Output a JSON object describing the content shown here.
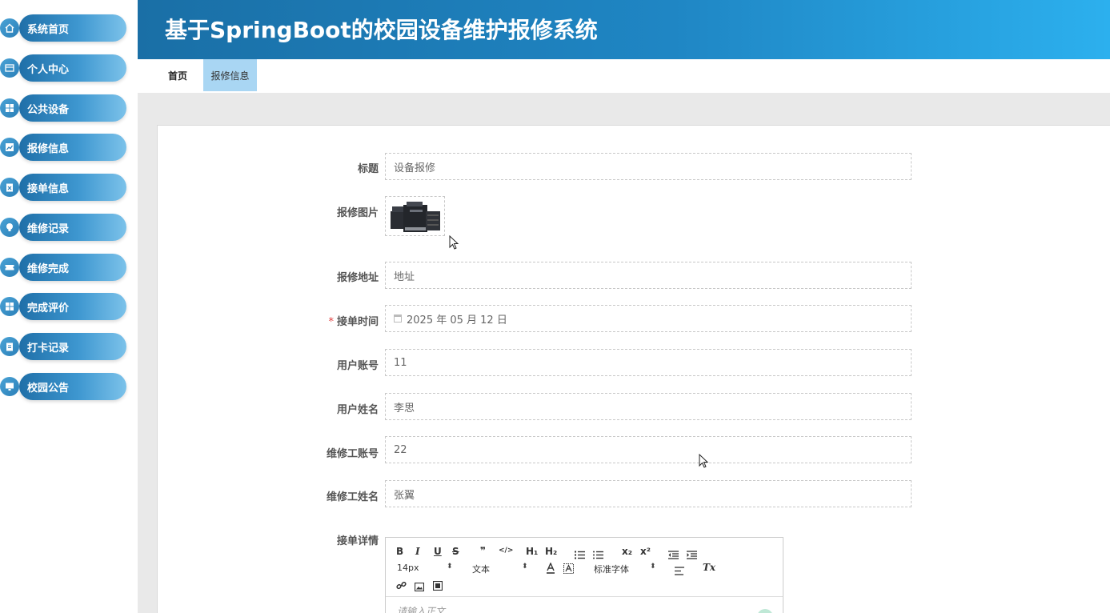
{
  "header": {
    "title": "基于SpringBoot的校园设备维护报修系统"
  },
  "sidebar": {
    "items": [
      {
        "label": "系统首页",
        "icon": "home-icon"
      },
      {
        "label": "个人中心",
        "icon": "card-icon"
      },
      {
        "label": "公共设备",
        "icon": "grid-icon"
      },
      {
        "label": "报修信息",
        "icon": "chart-icon"
      },
      {
        "label": "接单信息",
        "icon": "clipboard-x-icon"
      },
      {
        "label": "维修记录",
        "icon": "bulb-icon"
      },
      {
        "label": "维修完成",
        "icon": "ticket-icon"
      },
      {
        "label": "完成评价",
        "icon": "grid-icon"
      },
      {
        "label": "打卡记录",
        "icon": "clipboard-icon"
      },
      {
        "label": "校园公告",
        "icon": "monitor-icon"
      }
    ]
  },
  "tabs": {
    "home": "首页",
    "active": "报修信息"
  },
  "form": {
    "title": {
      "label": "标题",
      "value": "设备报修"
    },
    "image": {
      "label": "报修图片"
    },
    "address": {
      "label": "报修地址",
      "value": "地址"
    },
    "order_time": {
      "required": "*",
      "label": "接单时间",
      "value": "2025 年 05 月 12 日"
    },
    "user_account": {
      "label": "用户账号",
      "value": "11"
    },
    "user_name": {
      "label": "用户姓名",
      "value": "李思"
    },
    "worker_account": {
      "label": "维修工账号",
      "value": "22"
    },
    "worker_name": {
      "label": "维修工姓名",
      "value": "张翼"
    },
    "detail": {
      "label": "接单详情",
      "placeholder": "请输入正文..."
    }
  },
  "editor": {
    "font_size": "14px",
    "header_select": "文本",
    "font_family": "标准字体",
    "buttons": {
      "bold": "B",
      "italic": "I",
      "underline": "U",
      "strike": "S",
      "quote": "❞",
      "code": "</>",
      "h1": "H₁",
      "h2": "H₂",
      "sub": "x₂",
      "sup": "x²",
      "clean": "Tx"
    }
  }
}
